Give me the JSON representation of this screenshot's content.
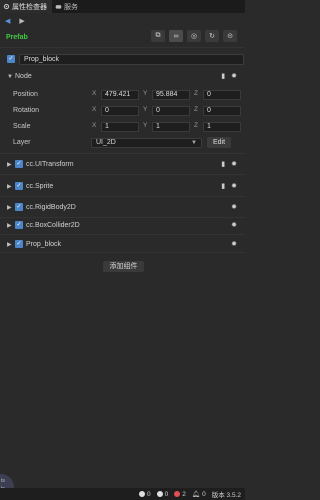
{
  "tabs": [
    {
      "label": "属性检查器",
      "icon": "gear-icon"
    },
    {
      "label": "服务",
      "icon": "cloud-icon"
    }
  ],
  "prefab": {
    "label": "Prefab"
  },
  "node_name": "Prop_block",
  "node_section": {
    "label": "Node"
  },
  "props": {
    "position": {
      "label": "Position",
      "x": "479.421",
      "y": "95.884",
      "z": "0"
    },
    "rotation": {
      "label": "Rotation",
      "x": "0",
      "y": "0",
      "z": "0"
    },
    "scale": {
      "label": "Scale",
      "x": "1",
      "y": "1",
      "z": "1"
    },
    "layer": {
      "label": "Layer",
      "value": "UI_2D",
      "edit": "Edit"
    }
  },
  "axes": {
    "x": "X",
    "y": "Y",
    "z": "Z"
  },
  "components": [
    {
      "label": "cc.UITransform"
    },
    {
      "label": "cc.Sprite"
    },
    {
      "label": "cc.RigidBody2D"
    },
    {
      "label": "cc.BoxCollider2D"
    },
    {
      "label": "Prop_block"
    }
  ],
  "add_component": "添加组件",
  "status": {
    "info": "0",
    "warn": "0",
    "err": "2",
    "bell": "0",
    "version": "版本 3.5.2"
  },
  "corner_text": "ts\nts",
  "colors": {
    "accent": "#4d86c8",
    "prefab": "#3fcb3f",
    "error": "#e05050"
  }
}
